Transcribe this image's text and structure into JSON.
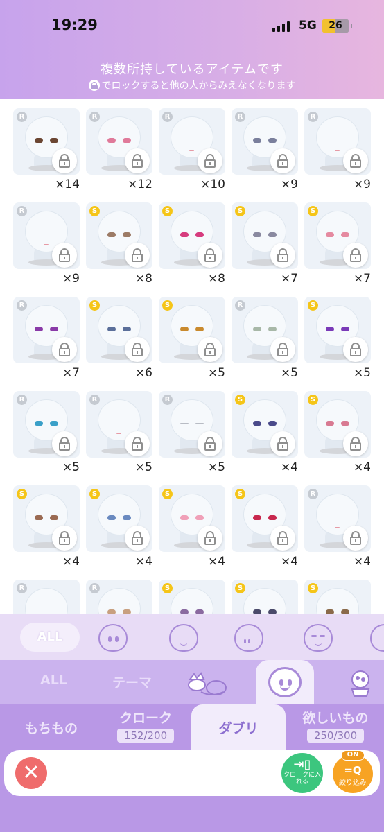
{
  "status": {
    "time": "19:29",
    "network": "5G",
    "battery": "26"
  },
  "hint": {
    "title": "複数所持しているアイテムです",
    "subtitle": "でロックすると他の人からみえなくなります"
  },
  "items": [
    {
      "rarity": "R",
      "count": "×14",
      "eye": "#6b4632"
    },
    {
      "rarity": "R",
      "count": "×12",
      "eye": "#e07a9a"
    },
    {
      "rarity": "R",
      "count": "×10",
      "eye": "none"
    },
    {
      "rarity": "R",
      "count": "×9",
      "eye": "#7a7f9c"
    },
    {
      "rarity": "R",
      "count": "×9",
      "eye": "none"
    },
    {
      "rarity": "R",
      "count": "×9",
      "eye": "none"
    },
    {
      "rarity": "S",
      "count": "×8",
      "eye": "#9c7b66"
    },
    {
      "rarity": "S",
      "count": "×8",
      "eye": "#d63c7e"
    },
    {
      "rarity": "S",
      "count": "×7",
      "eye": "#8a8aa0"
    },
    {
      "rarity": "S",
      "count": "×7",
      "eye": "#e58aa0"
    },
    {
      "rarity": "R",
      "count": "×7",
      "eye": "#8a3aa8"
    },
    {
      "rarity": "S",
      "count": "×6",
      "eye": "#5b6f9a"
    },
    {
      "rarity": "S",
      "count": "×5",
      "eye": "#c98a2e"
    },
    {
      "rarity": "R",
      "count": "×5",
      "eye": "#a8b8a8"
    },
    {
      "rarity": "S",
      "count": "×5",
      "eye": "#7a3ab8"
    },
    {
      "rarity": "R",
      "count": "×5",
      "eye": "#3aa0c8"
    },
    {
      "rarity": "R",
      "count": "×5",
      "eye": "none"
    },
    {
      "rarity": "R",
      "count": "×5",
      "eye": "line"
    },
    {
      "rarity": "S",
      "count": "×4",
      "eye": "#4a4a8a"
    },
    {
      "rarity": "S",
      "count": "×4",
      "eye": "#d87a92"
    },
    {
      "rarity": "S",
      "count": "×4",
      "eye": "#9a6a52"
    },
    {
      "rarity": "S",
      "count": "×4",
      "eye": "#6a8ac0"
    },
    {
      "rarity": "S",
      "count": "×4",
      "eye": "#f0a0b8"
    },
    {
      "rarity": "S",
      "count": "×4",
      "eye": "#c8284e"
    },
    {
      "rarity": "R",
      "count": "×4",
      "eye": "none"
    },
    {
      "rarity": "R",
      "count": "",
      "eye": "none"
    },
    {
      "rarity": "R",
      "count": "",
      "eye": "#c8a080"
    },
    {
      "rarity": "S",
      "count": "",
      "eye": "#8a6aa0"
    },
    {
      "rarity": "S",
      "count": "",
      "eye": "#4a4a6a"
    },
    {
      "rarity": "S",
      "count": "",
      "eye": "#8a6a4a"
    }
  ],
  "categories": {
    "all_label": "ALL"
  },
  "types": {
    "all_label": "ALL",
    "theme_label": "テーマ"
  },
  "tabs": {
    "mochimono": "もちもの",
    "cloak": "クローク",
    "cloak_count": "152/200",
    "daburi": "ダブリ",
    "wishlist": "欲しいもの",
    "wishlist_count": "250/300"
  },
  "actions": {
    "close": "✕",
    "put_label": "クロークに入れる",
    "filter_on": "ON",
    "filter_icon": "=Q",
    "filter_label": "絞り込み"
  },
  "colors": {
    "accent": "#b998e6",
    "header": "#d8aee6",
    "close": "#ef6c6c",
    "put": "#3cc67e",
    "filter": "#f7a323",
    "silver_badge": "#c5cad1",
    "gold_badge": "#f5c518"
  }
}
